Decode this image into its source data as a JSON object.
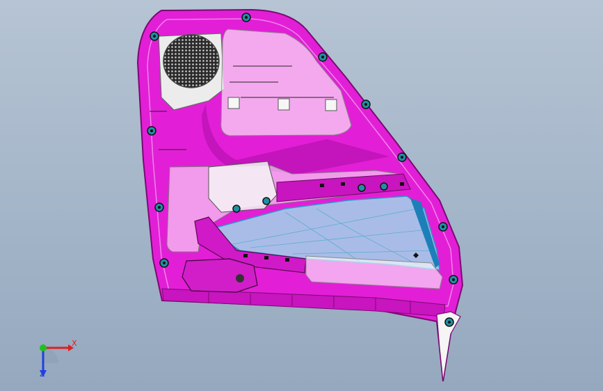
{
  "viewport": {
    "background_top": "#b6c4d4",
    "background_bottom": "#95a8be"
  },
  "model": {
    "panel_color": "#e21fd6",
    "panel_dark": "#9a0f92",
    "panel_light": "#f06ae8",
    "glass_color": "#9fd8ea",
    "glass_edge": "#2e97c8",
    "translucent_overlay": "#ffffff",
    "fastener_color": "#1f8fa3",
    "speaker_grille_color": "#2a2a2a",
    "icons": [
      "speaker-grille-icon",
      "fastener-clip-icon"
    ]
  },
  "triad": {
    "x_label": "X",
    "z_label": "Z",
    "x_color": "#e02020",
    "y_color": "#20c020",
    "z_color": "#2040e0"
  }
}
